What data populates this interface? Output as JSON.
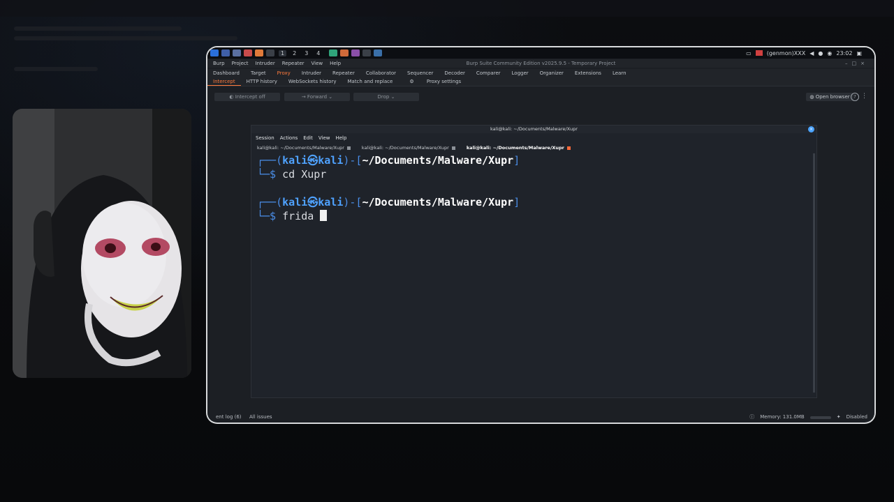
{
  "taskbar": {
    "workspaces": [
      "1",
      "2",
      "3",
      "4"
    ],
    "genmon": "(genmon)XXX",
    "clock": "23:02"
  },
  "burp": {
    "title": "Burp Suite Community Edition v2025.9.5 - Temporary Project",
    "menu": [
      "Burp",
      "Project",
      "Intruder",
      "Repeater",
      "View",
      "Help"
    ],
    "tabs": [
      "Dashboard",
      "Target",
      "Proxy",
      "Intruder",
      "Repeater",
      "Collaborator",
      "Sequencer",
      "Decoder",
      "Comparer",
      "Logger",
      "Organizer",
      "Extensions",
      "Learn"
    ],
    "subtabs": [
      "Intercept",
      "HTTP history",
      "WebSockets history",
      "Match and replace",
      "Proxy settings"
    ],
    "intercept_button": "Intercept off",
    "forward_button": "Forward",
    "drop_button": "Drop",
    "open_browser": "Open browser",
    "status": {
      "event_log": "ent log (6)",
      "issues": "All issues",
      "memory": "Memory: 131.0MB",
      "disabled": "Disabled"
    }
  },
  "terminal": {
    "title": "kali@kali: ~/Documents/Malware/Xupr",
    "menu": [
      "Session",
      "Actions",
      "Edit",
      "View",
      "Help"
    ],
    "tabs": [
      "kali@kali: ~/Documents/Malware/Xupr",
      "kali@kali: ~/Documents/Malware/Xupr",
      "kali@kali: ~/Documents/Malware/Xupr"
    ],
    "prompt_user": "kali㉿kali",
    "prompt_path": "~/Documents/Malware/Xupr",
    "cmd1": "cd Xupr",
    "cmd2": "frida "
  },
  "colors": {
    "accent": "#ff7a3c",
    "terminal_bg": "#1f232a",
    "prompt_blue": "#4fa2ff"
  }
}
